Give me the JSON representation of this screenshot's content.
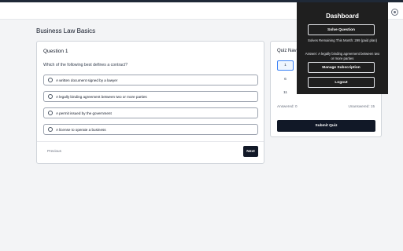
{
  "page": {
    "title": "Business Law Basics"
  },
  "question": {
    "title": "Question 1",
    "text": "Which of the following best defines a contract?",
    "options": [
      "A written document signed by a lawyer",
      "A legally binding agreement between two or more parties",
      "A permit issued by the government",
      "A license to operate a business"
    ],
    "previous_label": "Previous",
    "next_label": "Next"
  },
  "navigator": {
    "title": "Quiz Navi",
    "numbers": [
      "1",
      "6",
      "11"
    ],
    "answered": "Answered: 0",
    "unanswered": "Unanswered: 15",
    "submit_label": "Submit Quiz"
  },
  "dashboard": {
    "title": "Dashboard",
    "solve_label": "Solve Question",
    "solves_remaining": "Solves Remaining This Month: 299 (paid plan)",
    "answer": "Answer: A legally binding agreement between two or more parties",
    "manage_label": "Manage Subscription",
    "logout_label": "Logout"
  },
  "icons": {
    "settings": "settings-icon"
  },
  "colors": {
    "accent": "#111827",
    "overlay": "#1f1f1f",
    "active": "#3b82f6"
  }
}
